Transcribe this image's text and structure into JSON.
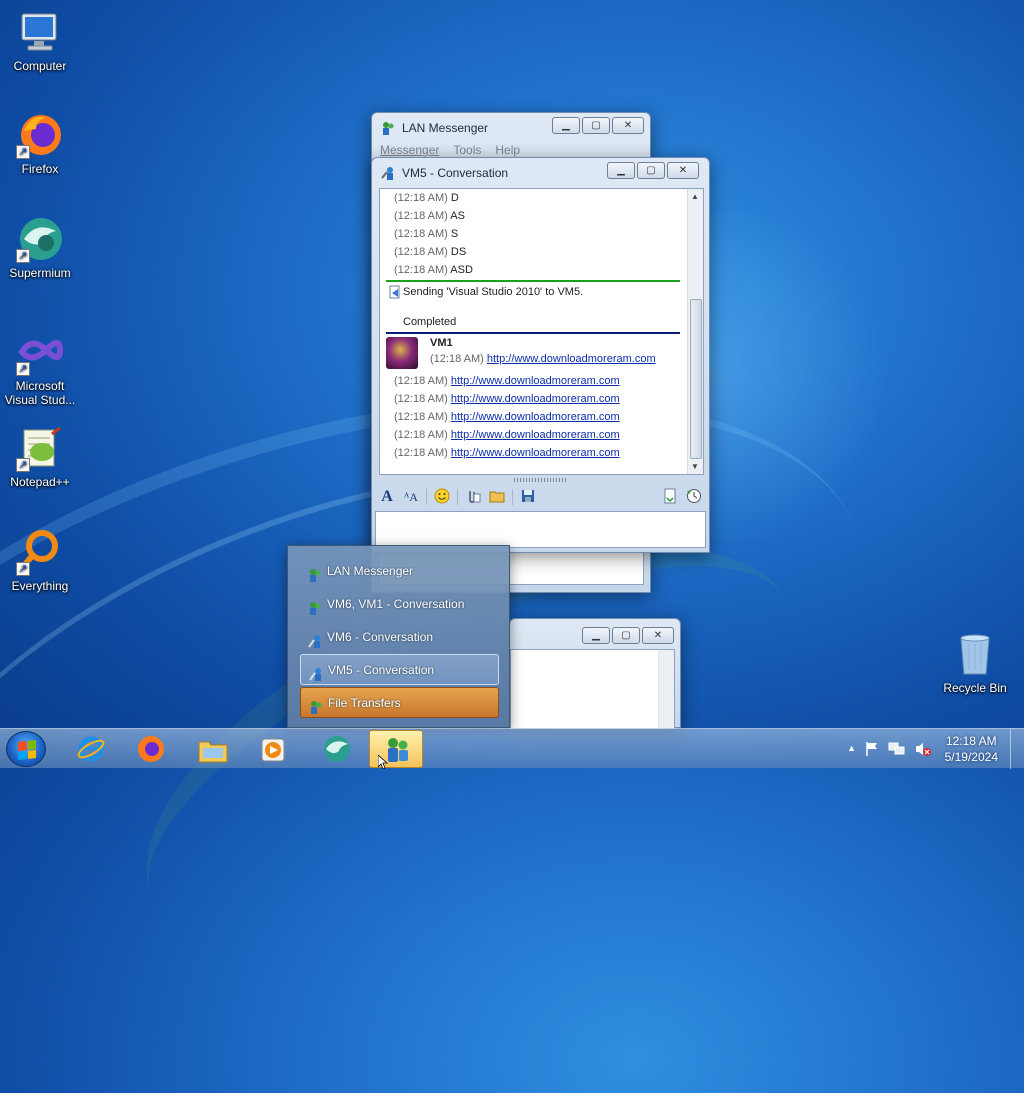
{
  "desktop": {
    "icons": [
      {
        "label": "Computer"
      },
      {
        "label": "Firefox"
      },
      {
        "label": "Supermium"
      },
      {
        "label": "Microsoft Visual Stud..."
      },
      {
        "label": "Notepad++"
      },
      {
        "label": "Everything"
      },
      {
        "label": "Recycle Bin"
      }
    ]
  },
  "lan_window": {
    "title": "LAN Messenger",
    "menu": [
      "Messenger",
      "Tools",
      "Help"
    ]
  },
  "conv_window": {
    "title": "VM5 - Conversation",
    "messages_top": [
      {
        "time": "(12:18 AM)",
        "text": "D"
      },
      {
        "time": "(12:18 AM)",
        "text": "AS"
      },
      {
        "time": "(12:18 AM)",
        "text": "S"
      },
      {
        "time": "(12:18 AM)",
        "text": "DS"
      },
      {
        "time": "(12:18 AM)",
        "text": "ASD"
      }
    ],
    "file_notice": "Sending 'Visual Studio 2010' to VM5.",
    "file_status": "Completed",
    "sender": "VM1",
    "first_msg": {
      "time": "(12:18 AM)",
      "link": "http://www.downloadmoreram.com"
    },
    "link_messages": [
      {
        "time": "(12:18 AM)",
        "link": "http://www.downloadmoreram.com"
      },
      {
        "time": "(12:18 AM)",
        "link": "http://www.downloadmoreram.com"
      },
      {
        "time": "(12:18 AM)",
        "link": "http://www.downloadmoreram.com"
      },
      {
        "time": "(12:18 AM)",
        "link": "http://www.downloadmoreram.com"
      },
      {
        "time": "(12:18 AM)",
        "link": "http://www.downloadmoreram.com"
      }
    ],
    "input_value": ""
  },
  "jumplist": {
    "items": [
      {
        "label": "LAN Messenger",
        "icon": "lan-messenger-icon"
      },
      {
        "label": "VM6, VM1 - Conversation",
        "icon": "group-conversation-icon"
      },
      {
        "label": "VM6 - Conversation",
        "icon": "conversation-icon"
      },
      {
        "label": "VM5 - Conversation",
        "icon": "conversation-icon"
      },
      {
        "label": "File Transfers",
        "icon": "file-transfer-icon"
      }
    ]
  },
  "taskbar": {
    "pinned": [
      "internet-explorer-icon",
      "firefox-icon",
      "file-explorer-icon",
      "media-player-icon",
      "supermium-icon",
      "lan-messenger-icon"
    ],
    "clock_time": "12:18 AM",
    "clock_date": "5/19/2024"
  },
  "colors": {
    "accent_green": "#1aa01a",
    "accent_navy": "#0b1f7a",
    "link": "#0b2ea8",
    "selected_orange": "#c7762c"
  }
}
